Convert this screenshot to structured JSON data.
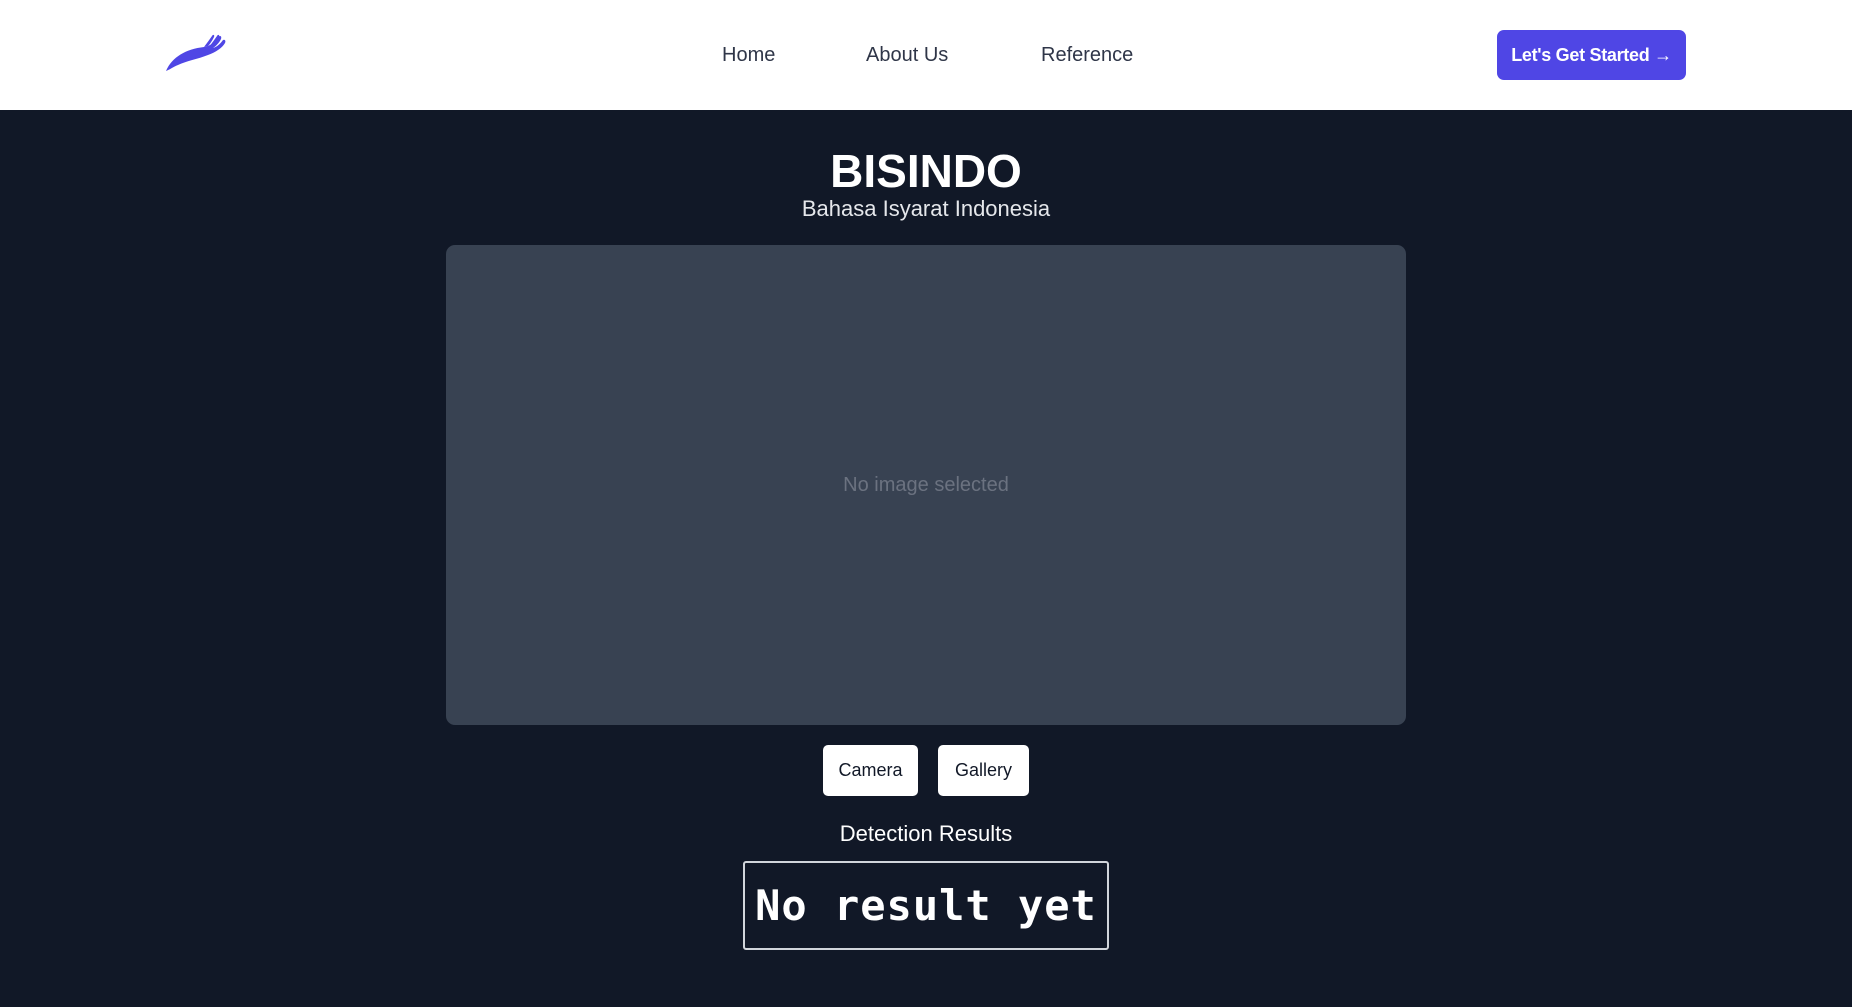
{
  "navbar": {
    "logo_icon": "hand-logo-icon",
    "links": [
      {
        "label": "Home"
      },
      {
        "label": "About Us"
      },
      {
        "label": "Reference"
      }
    ],
    "cta_label": "Let's Get Started →"
  },
  "hero": {
    "title": "BISINDO",
    "subtitle": "Bahasa Isyarat Indonesia"
  },
  "preview": {
    "placeholder": "No image selected"
  },
  "sources": {
    "camera_label": "Camera",
    "gallery_label": "Gallery"
  },
  "results": {
    "heading": "Detection Results",
    "value": "No result yet"
  },
  "colors": {
    "brand": "#4f46e5",
    "background": "#111827",
    "panel": "#384252",
    "navbar": "#ffffff"
  }
}
